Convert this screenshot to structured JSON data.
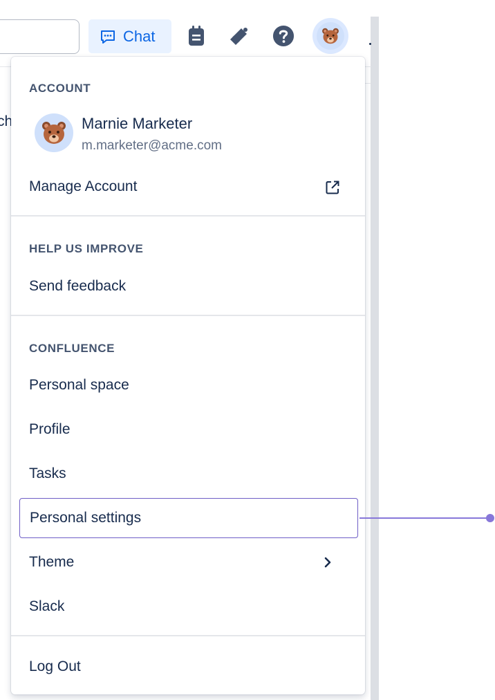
{
  "topbar": {
    "chat_label": "Chat",
    "partial_text": "ch",
    "icons": [
      "chat-icon",
      "notepad-icon",
      "megaphone-icon",
      "help-icon",
      "avatar"
    ]
  },
  "account_menu": {
    "account_heading": "ACCOUNT",
    "user_name": "Marnie Marketer",
    "user_email": "m.marketer@acme.com",
    "manage_account_label": "Manage Account",
    "help_heading": "HELP US IMPROVE",
    "send_feedback_label": "Send feedback",
    "confluence_heading": "CONFLUENCE",
    "items": [
      {
        "label": "Personal space"
      },
      {
        "label": "Profile"
      },
      {
        "label": "Tasks"
      },
      {
        "label": "Personal settings",
        "highlighted": true
      },
      {
        "label": "Theme"
      },
      {
        "label": "Slack"
      }
    ],
    "logout_label": "Log Out"
  },
  "colors": {
    "accent": "#0c66e4",
    "chat_bg": "#e9f2ff",
    "highlight": "#6e5dc6",
    "callout": "#8777d9",
    "text": "#172b4d",
    "heading": "#44546f"
  }
}
